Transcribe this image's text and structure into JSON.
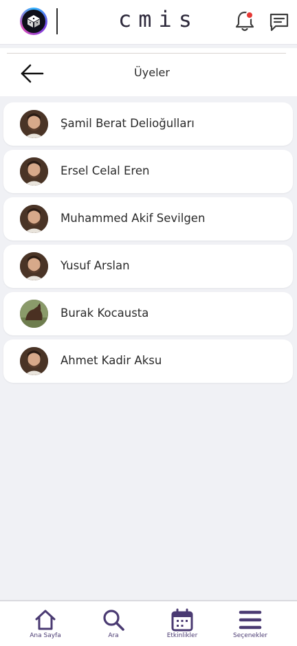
{
  "header": {
    "brand": "cmis",
    "logo": "cube-logo",
    "notification_icon": "bell-icon",
    "notification_badge_color": "#e53935",
    "messages_icon": "chat-icon"
  },
  "subheader": {
    "title": "Üyeler",
    "back_icon": "arrow-left-icon"
  },
  "members": [
    {
      "name": "Şamil Berat Delioğulları",
      "avatar": "person-photo"
    },
    {
      "name": "Ersel Celal Eren",
      "avatar": "person-photo"
    },
    {
      "name": "Muhammed Akif Sevilgen",
      "avatar": "person-photo"
    },
    {
      "name": "Yusuf Arslan",
      "avatar": "person-photo"
    },
    {
      "name": "Burak Kocausta",
      "avatar": "horse-photo"
    },
    {
      "name": "Ahmet Kadir Aksu",
      "avatar": "person-photo"
    }
  ],
  "bottom_nav": {
    "items": [
      {
        "label": "Ana Sayfa",
        "icon": "home-icon"
      },
      {
        "label": "Ara",
        "icon": "search-icon"
      },
      {
        "label": "Etkinlikler",
        "icon": "calendar-icon"
      },
      {
        "label": "Seçenekler",
        "icon": "menu-icon"
      }
    ]
  },
  "colors": {
    "accent": "#4a3a72",
    "background": "#f0f1f5",
    "card": "#ffffff"
  }
}
